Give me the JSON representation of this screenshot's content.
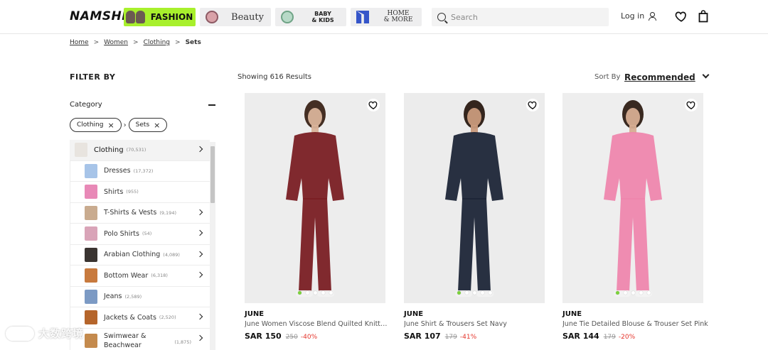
{
  "header": {
    "logo": "NAMSHI",
    "categories": [
      {
        "label": "FASHION"
      },
      {
        "label": "Beauty"
      },
      {
        "label": "BABY\n& KIDS"
      },
      {
        "label": "HOME\n& MORE"
      }
    ],
    "search_placeholder": "Search",
    "login_label": "Log in"
  },
  "breadcrumb": [
    "Home",
    "Women",
    "Clothing",
    "Sets"
  ],
  "filter": {
    "title": "FILTER BY",
    "category_heading": "Category",
    "chips": [
      "Clothing",
      "Sets"
    ],
    "items": [
      {
        "label": "Clothing",
        "count": "(70,531)",
        "thumb": "#e8e4df",
        "chevron": true,
        "main": true
      },
      {
        "label": "Dresses",
        "count": "(17,372)",
        "thumb": "#a7c4e8",
        "chevron": false
      },
      {
        "label": "Shirts",
        "count": "(955)",
        "thumb": "#e889b7",
        "chevron": false
      },
      {
        "label": "T-Shirts & Vests",
        "count": "(9,194)",
        "thumb": "#c9ab8f",
        "chevron": true
      },
      {
        "label": "Polo Shirts",
        "count": "(54)",
        "thumb": "#d9a4b8",
        "chevron": true
      },
      {
        "label": "Arabian Clothing",
        "count": "(4,089)",
        "thumb": "#3a3431",
        "chevron": true
      },
      {
        "label": "Bottom Wear",
        "count": "(6,318)",
        "thumb": "#c87a3e",
        "chevron": true
      },
      {
        "label": "Jeans",
        "count": "(2,589)",
        "thumb": "#7c9ac4",
        "chevron": false
      },
      {
        "label": "Jackets & Coats",
        "count": "(2,520)",
        "thumb": "#b5652b",
        "chevron": true
      },
      {
        "label": "Swimwear & Beachwear",
        "count": "(1,875)",
        "thumb": "#c48a4d",
        "chevron": true
      }
    ]
  },
  "results": {
    "count_text": "Showing 616 Results",
    "sort_label": "Sort By",
    "sort_value": "Recommended"
  },
  "products": [
    {
      "brand": "JUNE",
      "name": "June Women Viscose Blend Quilted Knitted Set",
      "price": "SAR 150",
      "was": "250",
      "discount": "-40%",
      "outfit_color": "#7a1f24",
      "bg": "#ededed",
      "skin": "#d9b39a",
      "hair": "#3b2418"
    },
    {
      "brand": "JUNE",
      "name": "June Shirt & Trousers Set Navy",
      "price": "SAR 107",
      "was": "179",
      "discount": "-41%",
      "outfit_color": "#1e2638",
      "bg": "#ececec",
      "skin": "#c99a7c",
      "hair": "#2a1a12"
    },
    {
      "brand": "JUNE",
      "name": "June Tie Detailed Blouse & Trouser Set Pink",
      "price": "SAR 144",
      "was": "179",
      "discount": "-20%",
      "outfit_color": "#ee86ad",
      "bg": "#eeeeee",
      "skin": "#d6ad92",
      "hair": "#2e1d14"
    }
  ],
  "watermark": "大数跨境",
  "colors": {
    "accent_green": "#a8f02c",
    "discount_red": "#e5352c"
  }
}
